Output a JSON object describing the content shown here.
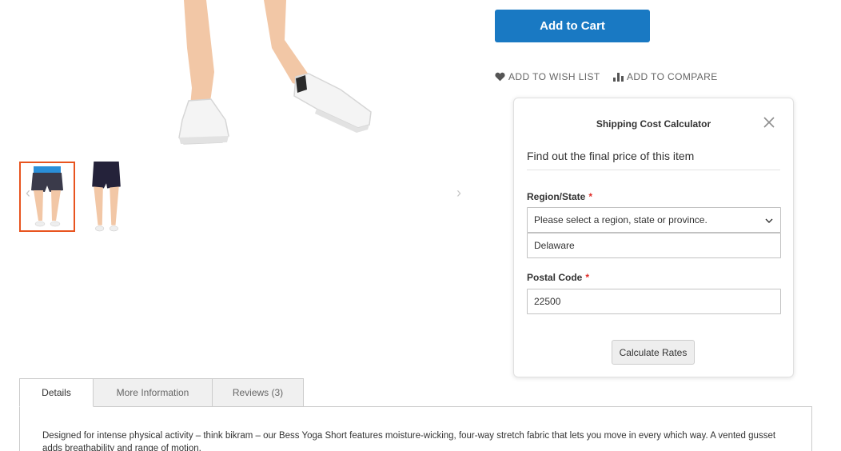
{
  "product": {
    "add_to_cart_label": "Add to Cart",
    "wishlist_label": "ADD TO WISH LIST",
    "compare_label": "ADD TO COMPARE",
    "gallery": {
      "thumbnails": [
        "front",
        "back"
      ],
      "active_thumbnail": 0
    }
  },
  "shipping_calculator": {
    "title": "Shipping Cost Calculator",
    "subtitle": "Find out the final price of this item",
    "region_label": "Region/State",
    "region_required_mark": "*",
    "region_select_value": "Please select a region, state or province.",
    "region_input_value": "Delaware",
    "postal_label": "Postal Code",
    "postal_required_mark": "*",
    "postal_value": "22500",
    "button_label": "Calculate Rates"
  },
  "tabs": {
    "items": [
      {
        "label": "Details",
        "active": true
      },
      {
        "label": "More Information",
        "active": false
      },
      {
        "label": "Reviews (3)",
        "active": false
      }
    ],
    "details_text": "Designed for intense physical activity – think bikram – our Bess Yoga Short features moisture-wicking, four-way stretch fabric that lets you move in every which way. A vented gusset adds breathability and range of motion."
  },
  "colors": {
    "primary_button": "#1979c3",
    "active_thumbnail_border": "#e8541f",
    "required_mark": "#e02b27"
  },
  "icons": {
    "wishlist": "heart-icon",
    "compare": "bar-chart-icon",
    "close": "close-icon",
    "select": "chevron-down-icon",
    "gallery_prev": "chevron-left-icon",
    "gallery_next": "chevron-right-icon"
  }
}
